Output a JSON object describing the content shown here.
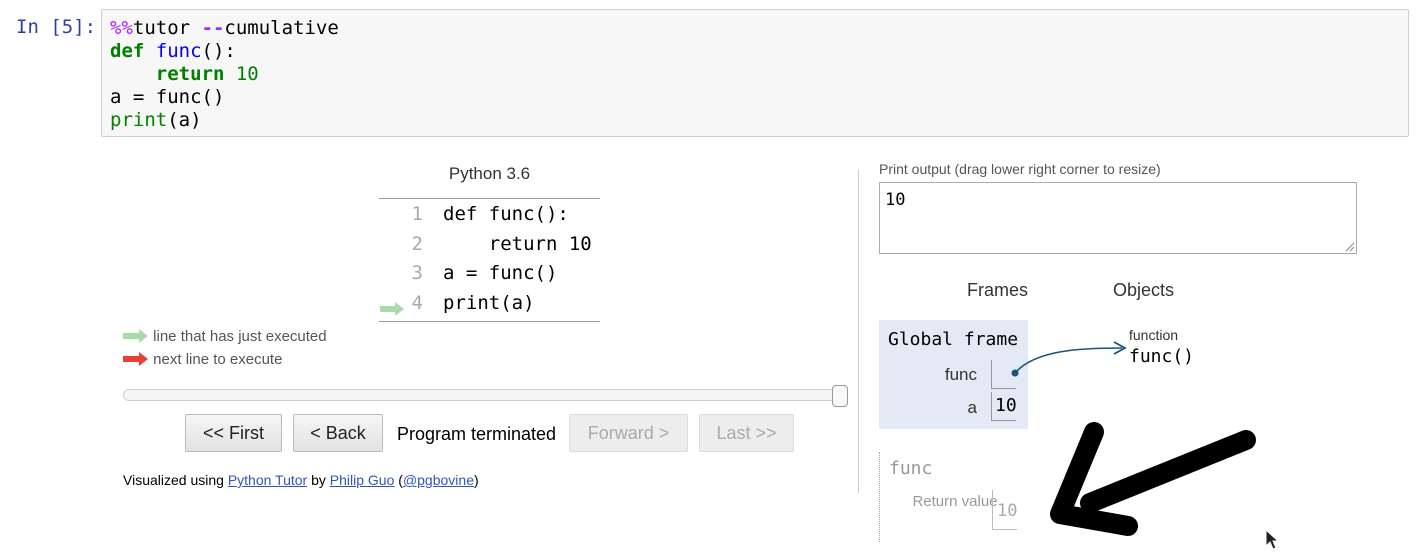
{
  "cell": {
    "prompt": "In [5]:",
    "lines": [
      [
        {
          "t": "%%",
          "c": "magic"
        },
        {
          "t": "tutor ",
          "c": ""
        },
        {
          "t": "--",
          "c": "op"
        },
        {
          "t": "cumulative",
          "c": ""
        }
      ],
      [
        {
          "t": "def",
          "c": "kw"
        },
        {
          "t": " ",
          "c": ""
        },
        {
          "t": "func",
          "c": "fn"
        },
        {
          "t": "():",
          "c": ""
        }
      ],
      [
        {
          "t": "    ",
          "c": ""
        },
        {
          "t": "return",
          "c": "kw"
        },
        {
          "t": " ",
          "c": ""
        },
        {
          "t": "10",
          "c": "num"
        }
      ],
      [
        {
          "t": "a = func()",
          "c": ""
        }
      ],
      [
        {
          "t": "print",
          "c": "bi"
        },
        {
          "t": "(a)",
          "c": ""
        }
      ]
    ]
  },
  "tutor": {
    "python_version": "Python 3.6",
    "code_lines": [
      {
        "num": "1",
        "text": "def func():"
      },
      {
        "num": "2",
        "text": "    return 10"
      },
      {
        "num": "3",
        "text": "a = func()"
      },
      {
        "num": "4",
        "text": "print(a)"
      }
    ],
    "current_line": 4,
    "legend": {
      "just_executed": "line that has just executed",
      "next_line": "next line to execute",
      "green_color": "#a9dba9",
      "red_color": "#e93f34"
    },
    "slider_position": 1.0,
    "buttons": {
      "first": "<< First",
      "back": "< Back",
      "forward": "Forward >",
      "last": "Last >>"
    },
    "status": "Program terminated",
    "credit": {
      "prefix": "Visualized using ",
      "link1": "Python Tutor",
      "mid": " by ",
      "link2": "Philip Guo",
      "open": " (",
      "link3": "@pgbovine",
      "close": ")"
    }
  },
  "output": {
    "label": "Print output (drag lower right corner to resize)",
    "text": "10"
  },
  "viz": {
    "frames_header": "Frames",
    "objects_header": "Objects",
    "global_frame": {
      "title": "Global frame",
      "vars": [
        {
          "name": "func",
          "value": ""
        },
        {
          "name": "a",
          "value": "10"
        }
      ]
    },
    "func_object": {
      "type": "function",
      "value": "func()"
    },
    "func_frame": {
      "title": "func",
      "return_label": "Return value",
      "return_value": "10"
    },
    "pointer_color": "#1b5279"
  }
}
